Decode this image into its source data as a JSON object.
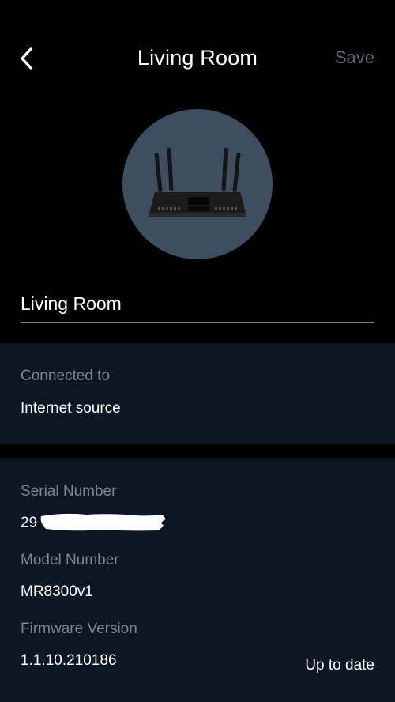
{
  "header": {
    "title": "Living Room",
    "save_label": "Save"
  },
  "device": {
    "name_value": "Living Room"
  },
  "connection": {
    "label": "Connected to",
    "value": "Internet source"
  },
  "details": {
    "serial_label": "Serial Number",
    "serial_visible": "29",
    "model_label": "Model Number",
    "model_value": "MR8300v1",
    "firmware_label": "Firmware Version",
    "firmware_value": "1.1.10.210186",
    "firmware_status": "Up to date"
  },
  "colors": {
    "background": "#000000",
    "card": "#0d1724",
    "avatar": "#3e4d60",
    "muted_text": "#7d848c",
    "disabled_action": "#5f6670"
  }
}
